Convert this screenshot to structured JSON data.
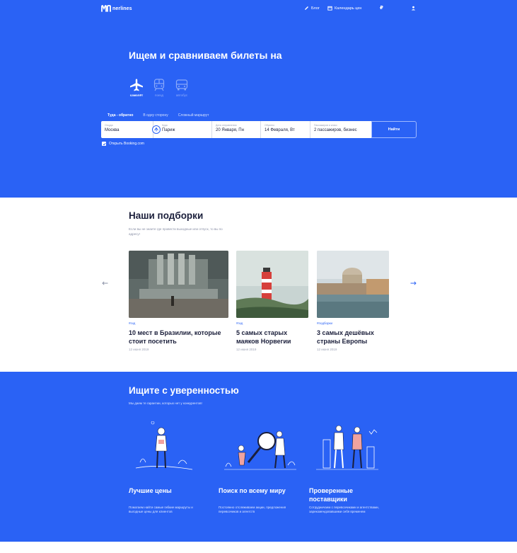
{
  "header": {
    "logo_text": "nerlines",
    "nav": {
      "blog": "Блог",
      "calendar": "Календарь цен",
      "currency": "₽"
    },
    "flag_colors": [
      "#ffffff",
      "#1f4fd8",
      "#e23b3b"
    ]
  },
  "hero": {
    "title": "Ищем и сравниваем билеты на",
    "modes": [
      {
        "label": "самолёт",
        "icon": "plane-icon",
        "active": true
      },
      {
        "label": "поезд",
        "icon": "train-icon",
        "active": false
      },
      {
        "label": "автобус",
        "icon": "bus-icon",
        "active": false
      }
    ],
    "trip_tabs": [
      "Туда - обратно",
      "В одну сторону",
      "Сложный маршрут"
    ],
    "fields": {
      "from": {
        "label": "Откуда",
        "value": "Москва"
      },
      "to": {
        "label": "Куда",
        "value": "Париж"
      },
      "depart": {
        "label": "Дата отправления",
        "value": "20 Января, Пн"
      },
      "return": {
        "label": "Обратно",
        "value": "14 Февраля, Вт"
      },
      "passengers": {
        "label": "Пассажиров и класс",
        "value": "2 пассажиров, бизнес"
      }
    },
    "search_button": "Найти",
    "booking_label": "Открыть Booking.com"
  },
  "picks": {
    "title": "Наши подборки",
    "subtitle": "Если вы не знаете где провести выходные или отпуск, то вы по адресу!",
    "cards": [
      {
        "tag": "#гид",
        "title": "10 мест в Бразилии, которые стоит посетить",
        "date": "12 июня 2019"
      },
      {
        "tag": "#гид",
        "title": "5 самых старых маяков Норвегии",
        "date": "12 июня 2019"
      },
      {
        "tag": "#подборки",
        "title": "3 самых дешёвых страны Европы",
        "date": "12 июня 2019"
      }
    ]
  },
  "confidence": {
    "title": "Ищите с уверенностью",
    "subtitle": "Мы даем те гарантии, которых нет у конкурентов!",
    "features": [
      {
        "title": "Лучшие цены",
        "desc": "Помогаем найти самые гибкие маршруты и выгодные цены для клиентов"
      },
      {
        "title": "Поиск по всему миру",
        "desc": "Постоянно отслеживаем акции, предложения перевозчиков и агентств"
      },
      {
        "title": "Проверенные поставщики",
        "desc": "Сотрудничаем с перевозчиками и агентствами, зарекомендовавшими себя временем"
      }
    ]
  },
  "colors": {
    "primary": "#2a62f5",
    "text": "#1b1f3b",
    "muted": "#8a90a6"
  }
}
